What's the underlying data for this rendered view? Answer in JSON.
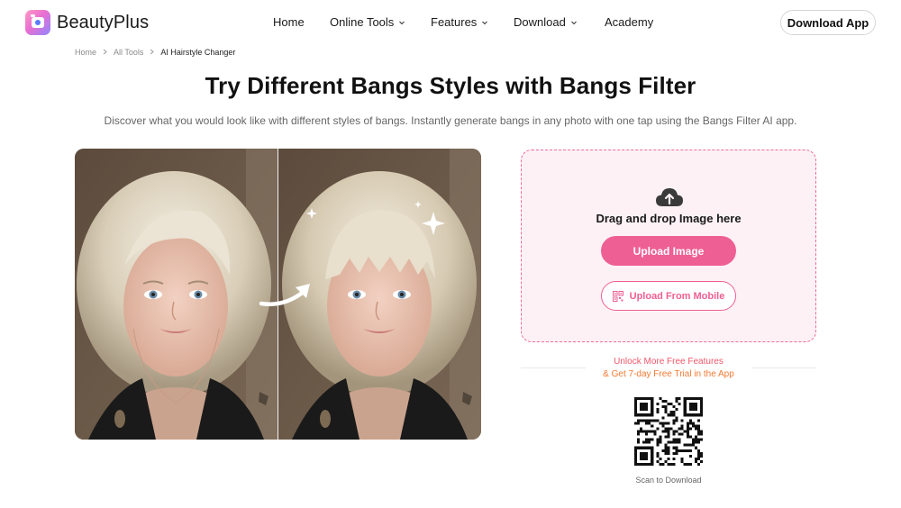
{
  "brand": {
    "name": "BeautyPlus"
  },
  "nav": {
    "items": [
      {
        "label": "Home",
        "has_dropdown": false
      },
      {
        "label": "Online Tools",
        "has_dropdown": true
      },
      {
        "label": "Features",
        "has_dropdown": true
      },
      {
        "label": "Download",
        "has_dropdown": true
      },
      {
        "label": "Academy",
        "has_dropdown": false
      }
    ],
    "download_app_label": "Download App"
  },
  "breadcrumb": [
    "Home",
    "All Tools",
    "AI Hairstyle Changer"
  ],
  "page": {
    "title": "Try Different Bangs Styles with Bangs Filter",
    "subtitle": "Discover what you would look like with different styles of bangs. Instantly generate bangs in any photo with one tap using the Bangs Filter AI app."
  },
  "upload": {
    "drag_text": "Drag and drop Image here",
    "upload_button": "Upload Image",
    "mobile_button": "Upload From Mobile"
  },
  "promo": {
    "line1": "Unlock More Free Features",
    "line2": "& Get 7-day Free Trial in the App",
    "scan_label": "Scan to Download"
  },
  "colors": {
    "accent_pink": "#ee5f93",
    "upload_bg": "#fdf1f6",
    "promo_red": "#f0576a",
    "promo_orange": "#f27a34"
  },
  "icons": [
    "chevron-down-icon",
    "breadcrumb-chevron-icon",
    "cloud-upload-icon",
    "qr-code-icon",
    "sparkle-icon",
    "curved-arrow-icon"
  ]
}
